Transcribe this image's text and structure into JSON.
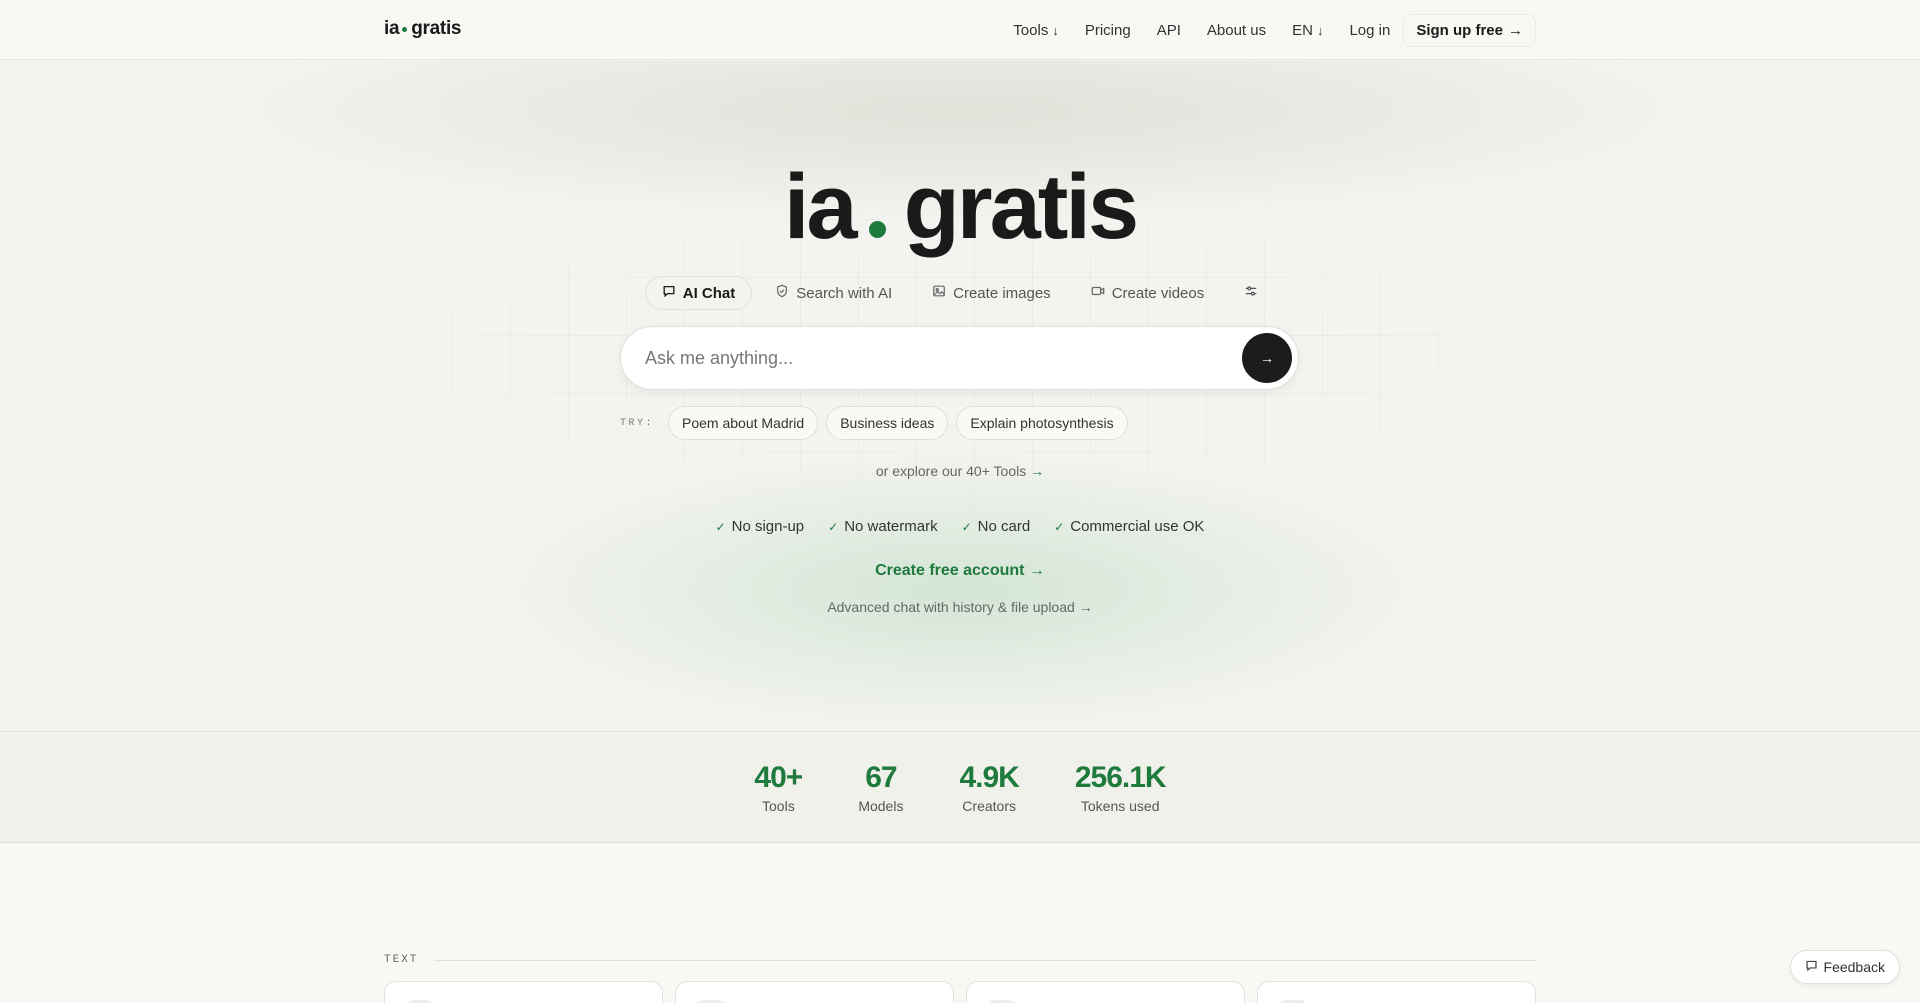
{
  "header": {
    "logo_left": "ia",
    "logo_right": "gratis",
    "nav": [
      {
        "label": "Tools",
        "arrow": "↓"
      },
      {
        "label": "Pricing"
      },
      {
        "label": "API"
      },
      {
        "label": "About us"
      },
      {
        "label": "EN",
        "arrow": "↓"
      },
      {
        "label": "Log in"
      }
    ],
    "signup_label": "Sign up free",
    "signup_arrow": "→"
  },
  "hero": {
    "title_left": "ia",
    "title_right": "gratis",
    "tabs": [
      {
        "label": "AI Chat",
        "icon": "chat-icon",
        "active": true
      },
      {
        "label": "Search with AI",
        "icon": "shield-icon"
      },
      {
        "label": "Create images",
        "icon": "image-icon"
      },
      {
        "label": "Create videos",
        "icon": "video-icon"
      }
    ],
    "search_placeholder": "Ask me anything...",
    "send_arrow": "→",
    "try_label": "TRY:",
    "suggestions": [
      "Poem about Madrid",
      "Business ideas",
      "Explain photosynthesis"
    ],
    "explore_text": "or explore our 40+ Tools",
    "explore_arrow": "→",
    "features": [
      "No sign-up",
      "No watermark",
      "No card",
      "Commercial use OK"
    ],
    "check_glyph": "✓",
    "create_account": "Create free account",
    "create_account_arrow": "→",
    "advanced_text": "Advanced chat with history & file upload",
    "advanced_arrow": "→"
  },
  "stats": [
    {
      "value": "40+",
      "label": "Tools"
    },
    {
      "value": "67",
      "label": "Models"
    },
    {
      "value": "4.9K",
      "label": "Creators"
    },
    {
      "value": "256.1K",
      "label": "Tokens used"
    }
  ],
  "section": {
    "label": "TEXT"
  },
  "feedback_label": "Feedback",
  "colors": {
    "accent": "#1f7a3d",
    "dark": "#1c1c1c",
    "background": "#f3f3ef"
  }
}
